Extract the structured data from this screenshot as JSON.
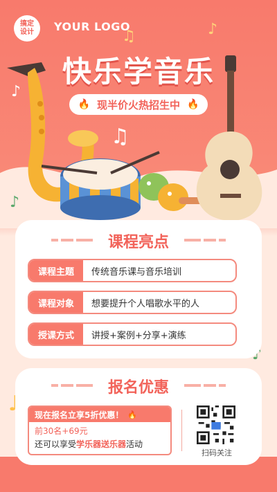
{
  "logo": {
    "badge": "搞定\n设计",
    "text": "YOUR LOGO"
  },
  "title": "快乐学音乐",
  "subtitle": "现半价火热招生中",
  "highlights": {
    "title": "课程亮点",
    "rows": [
      {
        "tag": "课程主题",
        "value": "传统音乐课与音乐培训"
      },
      {
        "tag": "课程对象",
        "value": "想要提升个人唱歌水平的人"
      },
      {
        "tag": "授课方式",
        "value": "讲授+案例+分享+演练"
      }
    ]
  },
  "signup": {
    "title": "报名优惠",
    "head": "现在报名立享5折优惠！",
    "line1": "前30名+69元",
    "line2_pre": "还可以享受",
    "line2_hl": "学乐器送乐器",
    "line2_post": "活动",
    "qr_label": "扫码关注"
  },
  "colors": {
    "accent": "#f87a6c",
    "accent_dark": "#f2635a"
  }
}
